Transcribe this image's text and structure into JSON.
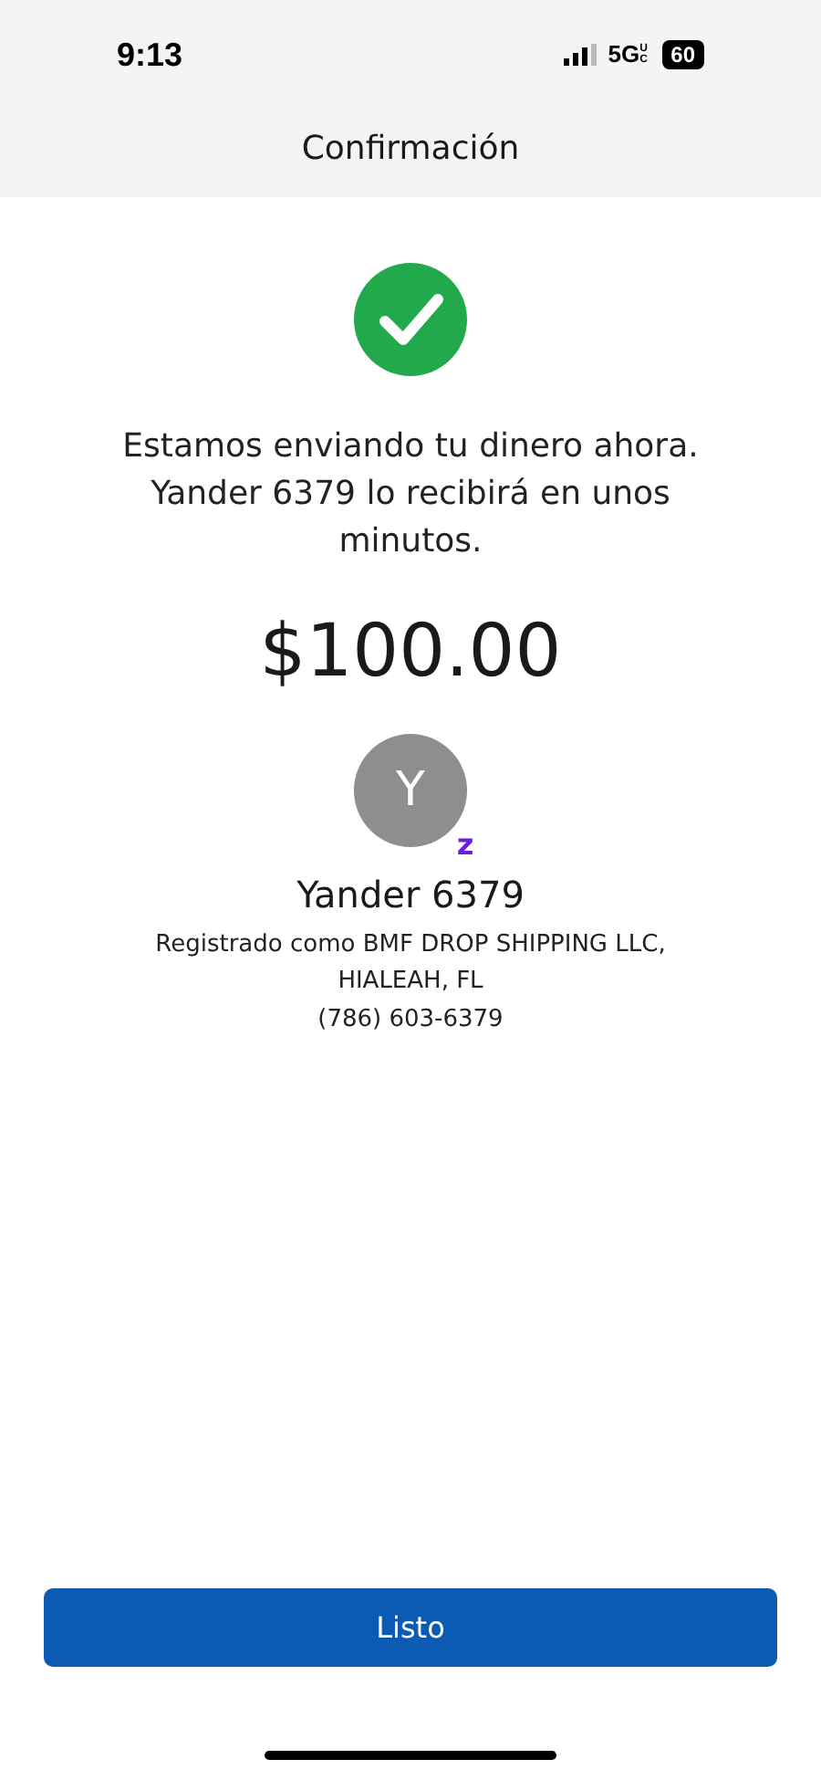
{
  "status_bar": {
    "time": "9:13",
    "network": "5G",
    "network_suffix": "UC",
    "battery": "60"
  },
  "header": {
    "title": "Confirmación"
  },
  "message": "Estamos enviando tu dinero ahora. Yander 6379 lo recibirá en unos minutos.",
  "amount": "$100.00",
  "recipient": {
    "initial": "Y",
    "badge": "z",
    "name": "Yander 6379",
    "registered_line_1": "Registrado como BMF DROP SHIPPING LLC,",
    "registered_line_2": "HIALEAH, FL",
    "phone": "(786) 603-6379"
  },
  "buttons": [
    {
      "label": "Listo"
    }
  ]
}
